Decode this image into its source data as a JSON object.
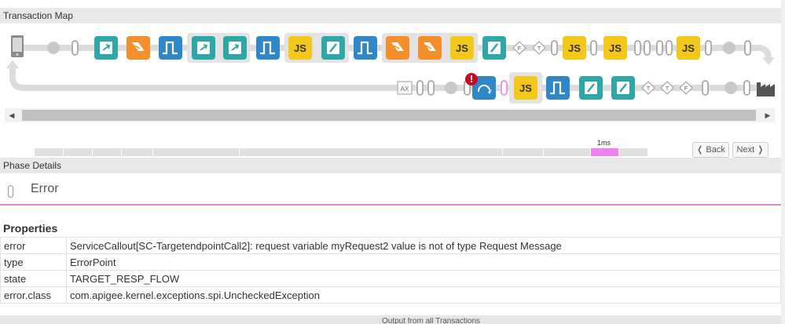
{
  "transaction_map": {
    "title": "Transaction Map",
    "top_row": [
      "mobile",
      "circle",
      "pipe",
      "callout",
      "extract",
      "flow",
      "callout",
      "callout",
      "flow",
      "js",
      "assign",
      "flow",
      "extract",
      "extract",
      "js",
      "assign",
      "diamond-F",
      "diamond-T",
      "pipe",
      "js",
      "pipe",
      "js",
      "pipe",
      "pipe",
      "js",
      "pipe",
      "circle"
    ],
    "bottom_row": [
      "ax",
      "pipe",
      "circle",
      "service-error",
      "pipe",
      "js",
      "flow",
      "assign",
      "assign",
      "diamond-T",
      "diamond-T",
      "diamond-F",
      "pipe",
      "circle",
      "factory"
    ],
    "ax_label": "AX",
    "js_label": "JS",
    "diamond_f": "F",
    "diamond_t": "T"
  },
  "scroll": {
    "left_arrow": "◀",
    "right_arrow": "▶"
  },
  "timeline": {
    "label": "1ms"
  },
  "nav": {
    "back": "❬ Back",
    "next": "Next ❭"
  },
  "phase_details": {
    "title": "Phase Details",
    "phase_name": "Error"
  },
  "properties": {
    "title": "Properties",
    "rows": [
      {
        "key": "error",
        "value": "ServiceCallout[SC-TargetendpointCall2]: request variable myRequest2 value is not of type Request Message"
      },
      {
        "key": "type",
        "value": "ErrorPoint"
      },
      {
        "key": "state",
        "value": "TARGET_RESP_FLOW"
      },
      {
        "key": "error.class",
        "value": "com.apigee.kernel.exceptions.spi.UncheckedException"
      }
    ]
  },
  "footer": {
    "text": "Output from all Transactions"
  },
  "colors": {
    "teal": "#2fa7a6",
    "orange": "#f58f2b",
    "blue": "#2f86c8",
    "yellow": "#f4c81a",
    "pink": "#f07ff0",
    "error": "#d0021b"
  }
}
